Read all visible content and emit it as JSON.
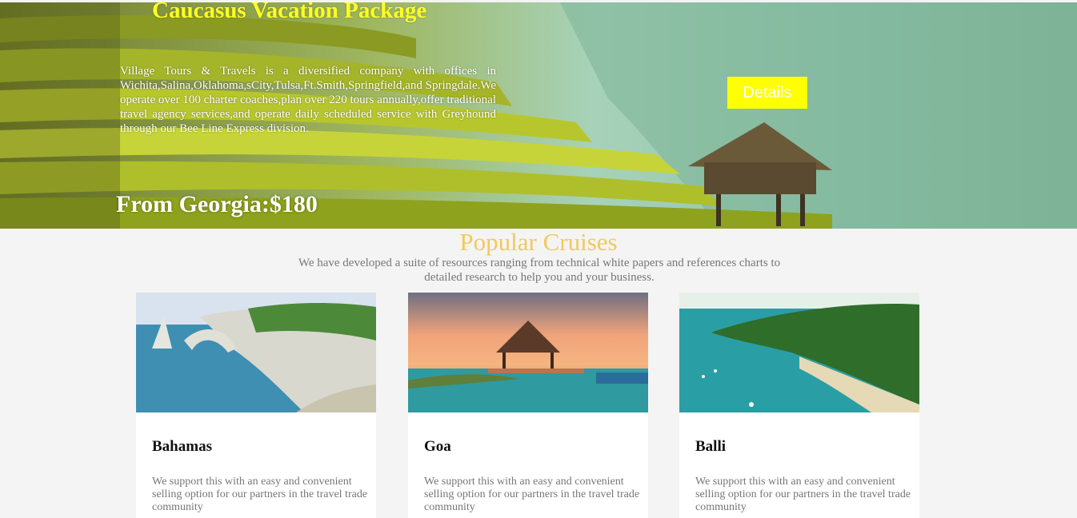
{
  "hero": {
    "title": "Caucasus Vacation Package",
    "description": "Village Tours & Travels is a diversified company with offices in Wichita,Salina,Oklahoma,sCity,Tulsa,Ft.Smith,Springfield,and Springdale.We operate over 100 charter coaches,plan over 220 tours annually,offer traditional travel agency services,and operate daily scheduled service with Greyhound through our Bee Line Express division.",
    "price": "From Georgia:$180",
    "button_label": "Details"
  },
  "popular": {
    "title": "Popular Cruises",
    "subtitle": "We have developed a suite of resources ranging from technical white papers and references charts to detailed research to help you and your business.",
    "cards": [
      {
        "name": "Bahamas",
        "text": "We support this with an easy and convenient selling option for our partners in the travel trade community"
      },
      {
        "name": "Goa",
        "text": "We support this with an easy and convenient selling option for our partners in the travel trade community"
      },
      {
        "name": "Balli",
        "text": "We support this with an easy and convenient selling option for our partners in the travel trade community"
      }
    ]
  },
  "colors": {
    "accent_yellow": "#ffff00",
    "section_title": "#f2c95a",
    "muted_text": "#777777"
  }
}
